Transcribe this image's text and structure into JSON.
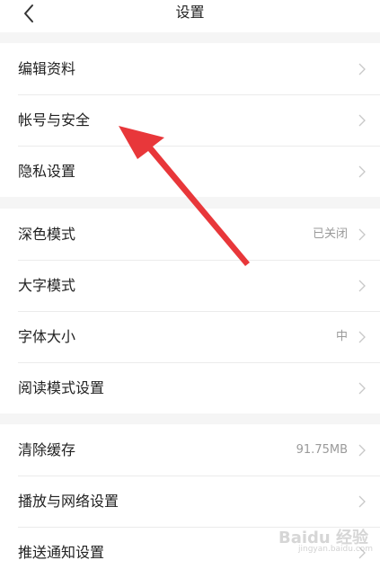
{
  "header": {
    "title": "设置",
    "back_icon": "chevron-left-icon"
  },
  "groups": [
    {
      "items": [
        {
          "label": "编辑资料",
          "value": ""
        },
        {
          "label": "帐号与安全",
          "value": ""
        },
        {
          "label": "隐私设置",
          "value": ""
        }
      ]
    },
    {
      "items": [
        {
          "label": "深色模式",
          "value": "已关闭"
        },
        {
          "label": "大字模式",
          "value": ""
        },
        {
          "label": "字体大小",
          "value": "中"
        },
        {
          "label": "阅读模式设置",
          "value": ""
        }
      ]
    },
    {
      "items": [
        {
          "label": "清除缓存",
          "value": "91.75MB"
        },
        {
          "label": "播放与网络设置",
          "value": ""
        },
        {
          "label": "推送通知设置",
          "value": ""
        }
      ]
    }
  ],
  "annotation": {
    "color": "#e8373a",
    "icon": "red-pointer-arrow"
  },
  "watermark": {
    "text": "Baidu 经验",
    "sub": "jingyan.baidu.com"
  },
  "colors": {
    "background": "#f5f5f5",
    "surface": "#ffffff",
    "text": "#222222",
    "secondary_text": "#9a9a9a",
    "divider": "#ebebeb"
  }
}
